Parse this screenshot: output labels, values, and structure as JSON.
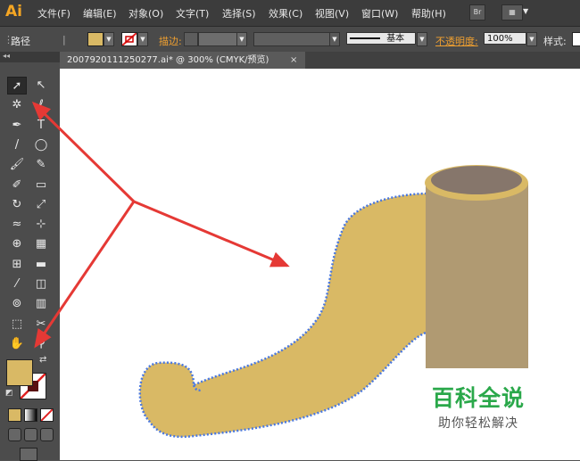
{
  "app": {
    "logo": "Ai"
  },
  "menubar": {
    "items": [
      "文件(F)",
      "编辑(E)",
      "对象(O)",
      "文字(T)",
      "选择(S)",
      "效果(C)",
      "视图(V)",
      "窗口(W)",
      "帮助(H)"
    ],
    "bridge_label": "Br"
  },
  "controlbar": {
    "selection_label": "路径",
    "stroke_label": "描边:",
    "stroke_style_label": "基本",
    "opacity_label": "不透明度:",
    "opacity_value": "100%",
    "style_label": "样式:",
    "fill_color": "#d9b965"
  },
  "document": {
    "tab_title": "2007920111250277.ai* @ 300% (CMYK/预览)",
    "close_glyph": "×"
  },
  "toolbox": {
    "collapse_glyph": "◂◂",
    "tools": [
      {
        "name": "selection-tool",
        "glyph": "➚"
      },
      {
        "name": "direct-selection-tool",
        "glyph": "↖"
      },
      {
        "name": "magic-wand-tool",
        "glyph": "✲"
      },
      {
        "name": "lasso-tool",
        "glyph": "ℓ"
      },
      {
        "name": "pen-tool",
        "glyph": "✒"
      },
      {
        "name": "type-tool",
        "glyph": "T"
      },
      {
        "name": "line-segment-tool",
        "glyph": "/"
      },
      {
        "name": "ellipse-tool",
        "glyph": "◯"
      },
      {
        "name": "paintbrush-tool",
        "glyph": "🖌"
      },
      {
        "name": "pencil-tool",
        "glyph": "✎"
      },
      {
        "name": "blob-brush-tool",
        "glyph": "✐"
      },
      {
        "name": "eraser-tool",
        "glyph": "▭"
      },
      {
        "name": "rotate-tool",
        "glyph": "↻"
      },
      {
        "name": "scale-tool",
        "glyph": "⤢"
      },
      {
        "name": "warp-tool",
        "glyph": "≈"
      },
      {
        "name": "free-transform-tool",
        "glyph": "⊹"
      },
      {
        "name": "shape-builder-tool",
        "glyph": "⊕"
      },
      {
        "name": "perspective-grid-tool",
        "glyph": "▦"
      },
      {
        "name": "mesh-tool",
        "glyph": "⊞"
      },
      {
        "name": "gradient-tool",
        "glyph": "▬"
      },
      {
        "name": "eyedropper-tool",
        "glyph": "⁄"
      },
      {
        "name": "blend-tool",
        "glyph": "◫"
      },
      {
        "name": "symbol-sprayer-tool",
        "glyph": "⊚"
      },
      {
        "name": "column-graph-tool",
        "glyph": "▥"
      },
      {
        "name": "artboard-tool",
        "glyph": "⬚"
      },
      {
        "name": "slice-tool",
        "glyph": "✂"
      },
      {
        "name": "hand-tool",
        "glyph": "✋"
      },
      {
        "name": "zoom-tool",
        "glyph": "⚲"
      }
    ]
  },
  "watermark": {
    "title": "百科全说",
    "subtitle": "助你轻松解决"
  },
  "colors": {
    "shape_fill": "#d9b965",
    "path_stroke": "#4a78e0",
    "cylinder_body": "#b09a72",
    "cylinder_top": "#86766b",
    "cylinder_rim": "#d9b965",
    "arrow": "#e53935"
  }
}
